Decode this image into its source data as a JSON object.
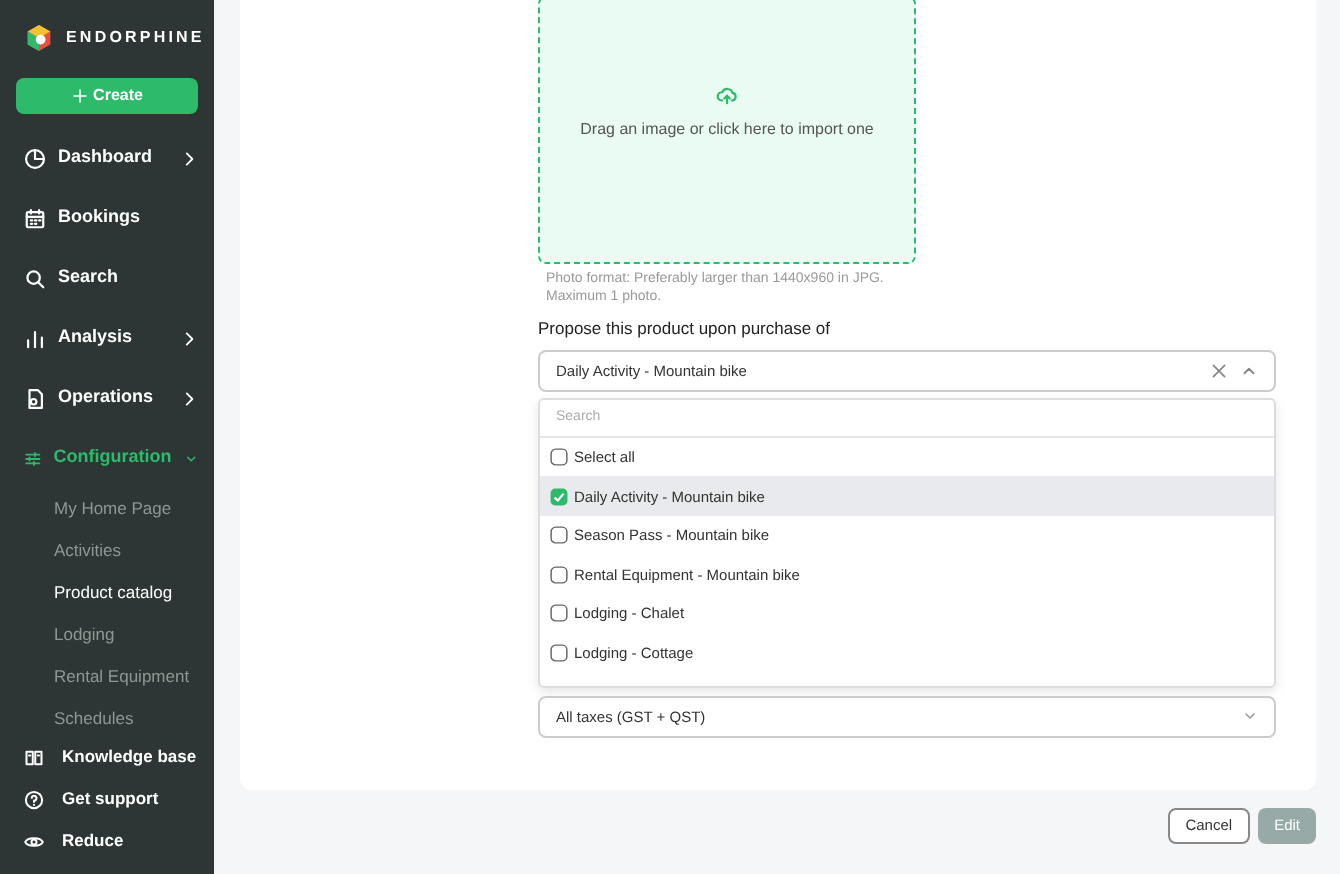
{
  "brand": {
    "name": "ENDORPHINE"
  },
  "create_button": {
    "label": "Create"
  },
  "nav": [
    {
      "label": "Dashboard",
      "kind": "collapsible",
      "expanded": false
    },
    {
      "label": "Bookings",
      "kind": "link"
    },
    {
      "label": "Search",
      "kind": "link"
    },
    {
      "label": "Analysis",
      "kind": "collapsible",
      "expanded": false
    },
    {
      "label": "Operations",
      "kind": "collapsible",
      "expanded": false
    },
    {
      "label": "Configuration",
      "kind": "collapsible",
      "expanded": true,
      "children": [
        {
          "label": "My Home Page",
          "selected": false
        },
        {
          "label": "Activities",
          "selected": false
        },
        {
          "label": "Product catalog",
          "selected": true
        },
        {
          "label": "Lodging",
          "selected": false
        },
        {
          "label": "Rental Equipment",
          "selected": false
        },
        {
          "label": "Schedules",
          "selected": false
        }
      ]
    }
  ],
  "footer_nav": [
    {
      "label": "Knowledge base"
    },
    {
      "label": "Get support"
    },
    {
      "label": "Reduce"
    }
  ],
  "upload": {
    "prompt": "Drag an image or click here to import one",
    "hint": "Photo format: Preferably larger than 1440x960 in JPG. Maximum 1 photo."
  },
  "propose": {
    "label": "Propose this product upon purchase of",
    "value": "Daily Activity - Mountain bike",
    "expanded": true,
    "search_placeholder": "Search",
    "options": [
      {
        "label": "Select all",
        "checked": false,
        "selected": false
      },
      {
        "label": "Daily Activity - Mountain bike",
        "checked": true,
        "selected": true
      },
      {
        "label": "Season Pass - Mountain bike",
        "checked": false,
        "selected": false
      },
      {
        "label": "Rental Equipment - Mountain bike",
        "checked": false,
        "selected": false
      },
      {
        "label": "Lodging - Chalet",
        "checked": false,
        "selected": false
      },
      {
        "label": "Lodging - Cottage",
        "checked": false,
        "selected": false
      }
    ]
  },
  "taxes": {
    "value": "All taxes (GST + QST)"
  },
  "buttons": [
    {
      "label": "Cancel",
      "kind": "secondary",
      "disabled": false
    },
    {
      "label": "Edit",
      "kind": "primary",
      "disabled": true
    }
  ]
}
